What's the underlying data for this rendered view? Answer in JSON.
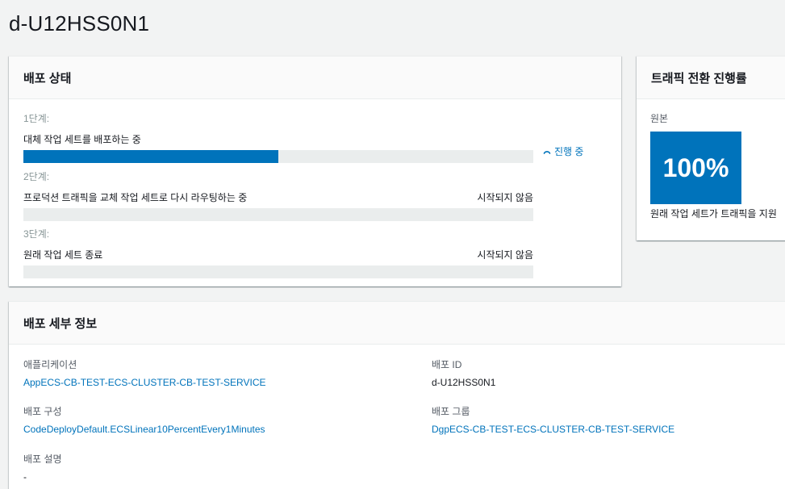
{
  "page_title": "d-U12HSS0N1",
  "status_panel": {
    "title": "배포 상태",
    "steps": [
      {
        "label": "1단계:",
        "description": "대체 작업 세트를 배포하는 중",
        "status": "",
        "progress": 0.5
      },
      {
        "label": "2단계:",
        "description": "프로덕션 트래픽을 교체 작업 세트로 다시 라우팅하는 중",
        "status": "시작되지 않음",
        "progress": 0
      },
      {
        "label": "3단계:",
        "description": "원래 작업 세트 종료",
        "status": "시작되지 않음",
        "progress": 0
      }
    ],
    "in_progress_text": "진행 중",
    "in_progress_icon": "spinner-icon",
    "accent_color": "#0073bb"
  },
  "traffic_panel": {
    "title": "트래픽 전환 진행률",
    "label": "원본",
    "percent": "100%",
    "caption": "원래 작업 세트가 트래픽을 지원"
  },
  "details_panel": {
    "title": "배포 세부 정보",
    "application_label": "애플리케이션",
    "application_value": "AppECS-CB-TEST-ECS-CLUSTER-CB-TEST-SERVICE",
    "deployment_id_label": "배포 ID",
    "deployment_id_value": "d-U12HSS0N1",
    "config_label": "배포 구성",
    "config_value": "CodeDeployDefault.ECSLinear10PercentEvery1Minutes",
    "group_label": "배포 그룹",
    "group_value": "DgpECS-CB-TEST-ECS-CLUSTER-CB-TEST-SERVICE",
    "description_label": "배포 설명",
    "description_value": "-"
  }
}
